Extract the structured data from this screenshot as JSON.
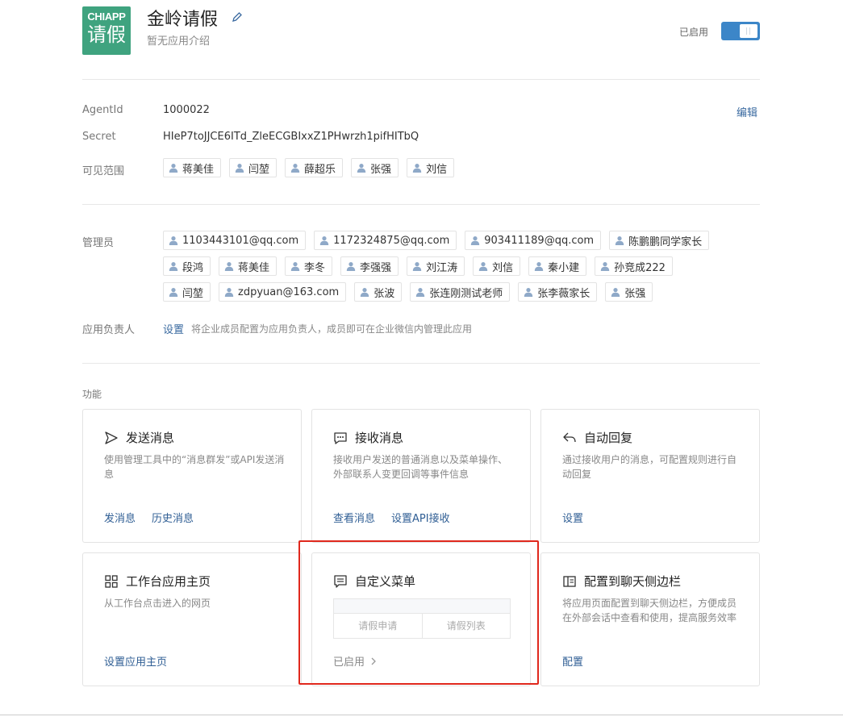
{
  "app": {
    "logo_top": "CHIAPP",
    "logo_bottom": "请假",
    "name": "金岭请假",
    "description": "暂无应用介绍",
    "status_label": "已启用"
  },
  "info": {
    "agentid_label": "AgentId",
    "agentid_value": "1000022",
    "edit_label": "编辑",
    "secret_label": "Secret",
    "secret_value": "HIeP7toJJCE6ITd_ZleECGBIxxZ1PHwrzh1pifHITbQ",
    "visible_label": "可见范围",
    "visible": [
      "蒋美佳",
      "闫堃",
      "薛超乐",
      "张强",
      "刘信"
    ]
  },
  "admins": {
    "label": "管理员",
    "rows": [
      [
        "1103443101@qq.com",
        "1172324875@qq.com",
        "903411189@qq.com",
        "陈鹏鹏同学家长"
      ],
      [
        "段鸿",
        "蒋美佳",
        "李冬",
        "李强强",
        "刘江涛",
        "刘信",
        "秦小建",
        "孙竞成222"
      ],
      [
        "闫堃",
        "zdpyuan@163.com",
        "张波",
        "张连刚测试老师",
        "张李薇家长",
        "张强"
      ]
    ]
  },
  "owner": {
    "label": "应用负责人",
    "link": "设置",
    "hint": "将企业成员配置为应用负责人，成员即可在企业微信内管理此应用"
  },
  "functions": {
    "label": "功能",
    "send": {
      "title": "发送消息",
      "desc": "使用管理工具中的“消息群发”或API发送消息",
      "links": [
        "发消息",
        "历史消息"
      ]
    },
    "receive": {
      "title": "接收消息",
      "desc": "接收用户发送的普通消息以及菜单操作、外部联系人变更回调等事件信息",
      "links": [
        "查看消息",
        "设置API接收"
      ]
    },
    "autoreply": {
      "title": "自动回复",
      "desc": "通过接收用户的消息，可配置规则进行自动回复",
      "links": [
        "设置"
      ]
    },
    "workbench": {
      "title": "工作台应用主页",
      "desc": "从工作台点击进入的网页",
      "links": [
        "设置应用主页"
      ]
    },
    "menu": {
      "title": "自定义菜单",
      "items": [
        "请假申请",
        "请假列表"
      ],
      "status": "已启用"
    },
    "sidebar": {
      "title": "配置到聊天侧边栏",
      "desc": "将应用页面配置到聊天侧边栏，方便成员在外部会话中查看和使用，提高服务效率",
      "links": [
        "配置"
      ]
    }
  },
  "colors": {
    "accent": "#3c86c8",
    "link": "#2f5e94",
    "logo": "#3fa37f",
    "highlight": "#e0281d"
  }
}
